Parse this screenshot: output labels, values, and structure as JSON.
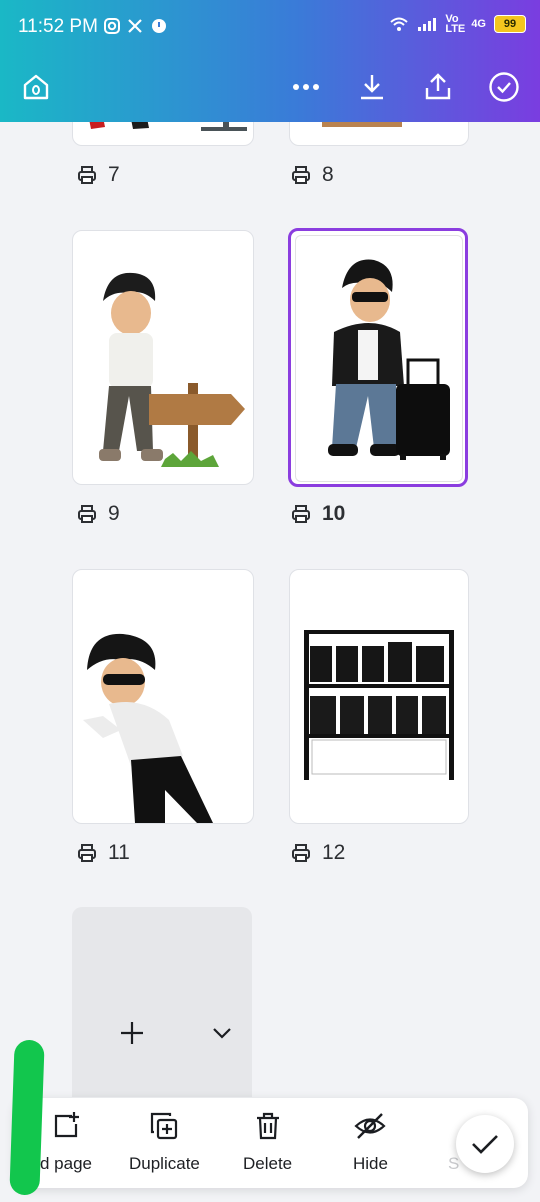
{
  "status_bar": {
    "time": "11:52 PM",
    "network": "4G",
    "volte": "Vo LTE",
    "battery": "99"
  },
  "app_bar": {
    "icons": [
      "home-icon",
      "more-icon",
      "download-icon",
      "share-icon",
      "check-circle-icon"
    ]
  },
  "pages": [
    {
      "number": "7"
    },
    {
      "number": "8"
    },
    {
      "number": "9"
    },
    {
      "number": "10",
      "selected": true
    },
    {
      "number": "11"
    },
    {
      "number": "12"
    }
  ],
  "toolbar": {
    "add_page": "d page",
    "duplicate": "Duplicate",
    "delete": "Delete",
    "hide": "Hide",
    "more": "S"
  },
  "colors": {
    "accent": "#8b3ddf",
    "gradient_start": "#1ab8c6",
    "gradient_end": "#7a3de0"
  }
}
